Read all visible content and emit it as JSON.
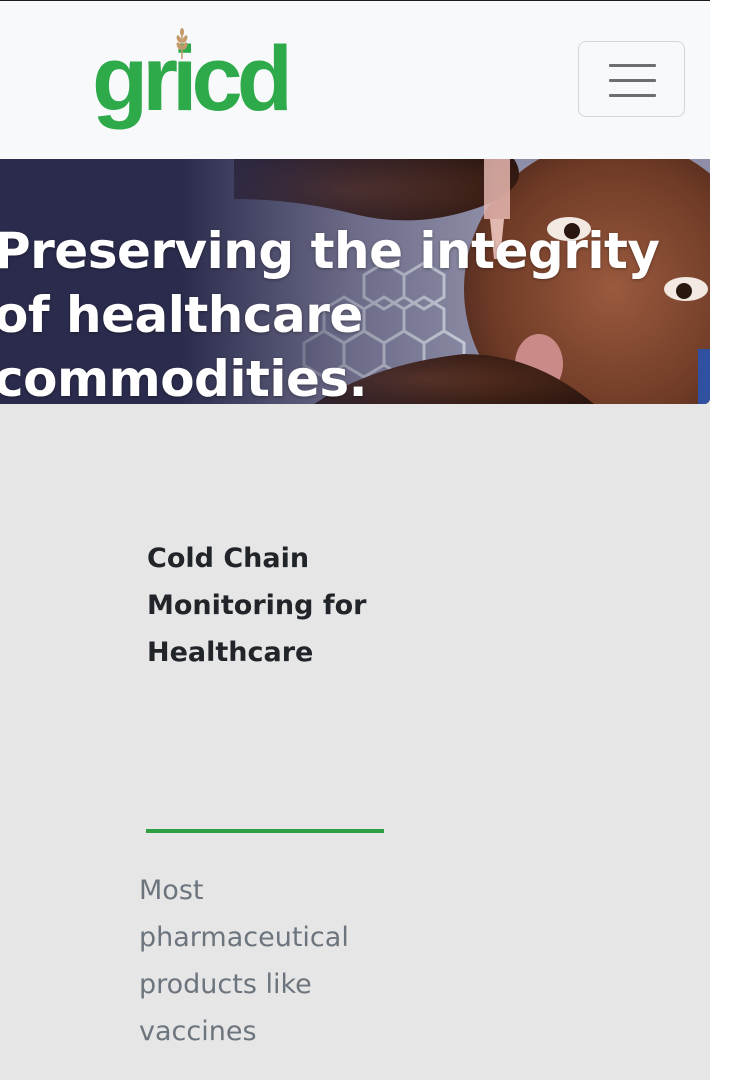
{
  "navbar": {
    "logo_text": "gricd",
    "logo_color": "#2eaa4a",
    "toggle_icon": "hamburger-icon"
  },
  "hero": {
    "title": "Preserving the integrity of healthcare commodities."
  },
  "feature": {
    "title": "Cold Chain Monitoring for Healthcare",
    "text": "Most pharmaceutical products like vaccines",
    "divider_color": "#2ea043"
  }
}
